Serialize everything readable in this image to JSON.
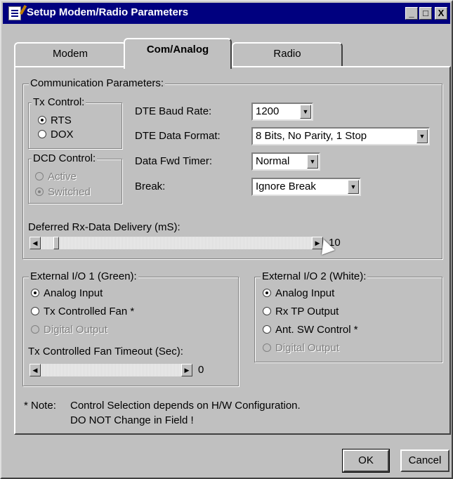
{
  "window": {
    "title": "Setup Modem/Radio Parameters",
    "controls": {
      "minimize": "_",
      "maximize": "□",
      "close": "X"
    }
  },
  "tabs": [
    {
      "label": "Modem",
      "active": false
    },
    {
      "label": "Com/Analog",
      "active": true
    },
    {
      "label": "Radio",
      "active": false
    }
  ],
  "comm": {
    "legend": "Communication Parameters:",
    "tx_control": {
      "legend": "Tx Control:",
      "options": [
        "RTS",
        "DOX"
      ],
      "selected": "RTS"
    },
    "dcd_control": {
      "legend": "DCD Control:",
      "options": [
        "Active",
        "Switched"
      ],
      "selected": "Switched",
      "disabled": true
    },
    "baud_rate": {
      "label": "DTE Baud Rate:",
      "value": "1200"
    },
    "data_format": {
      "label": "DTE Data Format:",
      "value": "8 Bits, No Parity, 1 Stop"
    },
    "fwd_timer": {
      "label": "Data Fwd Timer:",
      "value": "Normal"
    },
    "break": {
      "label": "Break:",
      "value": "Ignore Break"
    },
    "deferred": {
      "label": "Deferred Rx-Data Delivery (mS):",
      "value": "10"
    }
  },
  "ext_io_1": {
    "legend": "External I/O 1 (Green):",
    "options": [
      {
        "label": "Analog Input",
        "checked": true,
        "disabled": false
      },
      {
        "label": "Tx Controlled Fan *",
        "checked": false,
        "disabled": false
      },
      {
        "label": "Digital Output",
        "checked": false,
        "disabled": true
      }
    ],
    "fan_timeout": {
      "label": "Tx Controlled Fan Timeout (Sec):",
      "value": "0"
    }
  },
  "ext_io_2": {
    "legend": "External I/O 2 (White):",
    "options": [
      {
        "label": "Analog Input",
        "checked": true,
        "disabled": false
      },
      {
        "label": "Rx TP Output",
        "checked": false,
        "disabled": false
      },
      {
        "label": "Ant. SW Control *",
        "checked": false,
        "disabled": false
      },
      {
        "label": "Digital Output",
        "checked": false,
        "disabled": true
      }
    ]
  },
  "note": {
    "prefix": "* Note:",
    "line1": "Control Selection depends on H/W Configuration.",
    "line2": "DO NOT Change in Field !"
  },
  "buttons": {
    "ok": "OK",
    "cancel": "Cancel"
  },
  "icons": {
    "title": "app-icon",
    "arrows": {
      "down": "▼",
      "left": "◀",
      "right": "▶"
    }
  }
}
